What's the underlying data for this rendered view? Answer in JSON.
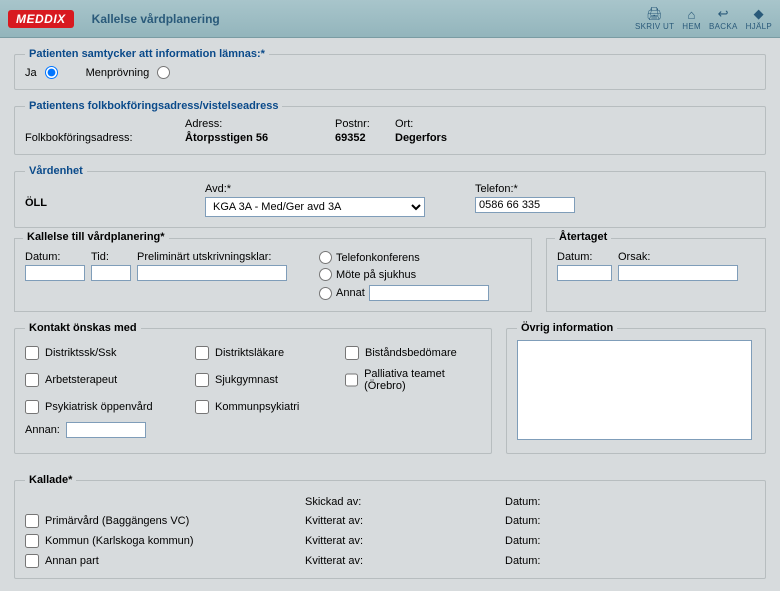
{
  "app": {
    "logo": "MEDDIX",
    "title": "Kallelse vårdplanering"
  },
  "toolbar": {
    "print": "SKRIV UT",
    "home": "HEM",
    "back": "BACKA",
    "help": "HJÄLP"
  },
  "consent": {
    "legend": "Patienten samtycker att information lämnas:*",
    "yes_label": "Ja",
    "trial_label": "Menprövning"
  },
  "address": {
    "legend": "Patientens folkbokföringsadress/vistelseadress",
    "addr_hdr": "Adress:",
    "post_hdr": "Postnr:",
    "ort_hdr": "Ort:",
    "folk_label": "Folkbokföringsadress:",
    "street": "Åtorpsstigen 56",
    "postnr": "69352",
    "ort": "Degerfors"
  },
  "unit": {
    "legend": "Vårdenhet",
    "org": "ÖLL",
    "dept_label": "Avd:*",
    "dept_value": "KGA 3A - Med/Ger avd 3A",
    "phone_label": "Telefon:*",
    "phone_value": "0586 66 335"
  },
  "callout": {
    "legend": "Kallelse till vårdplanering*",
    "date_label": "Datum:",
    "time_label": "Tid:",
    "prelim_label": "Preliminärt utskrivningsklar:",
    "opt_phone": "Telefonkonferens",
    "opt_hosp": "Möte på sjukhus",
    "opt_other": "Annat"
  },
  "retracted": {
    "legend": "Återtaget",
    "date_label": "Datum:",
    "reason_label": "Orsak:"
  },
  "contact": {
    "legend": "Kontakt önskas med",
    "c1": "Distriktssk/Ssk",
    "c2": "Distriktsläkare",
    "c3": "Biståndsbedömare",
    "c4": "Arbetsterapeut",
    "c5": "Sjukgymnast",
    "c6": "Palliativa teamet (Örebro)",
    "c7": "Psykiatrisk öppenvård",
    "c8": "Kommunpsykiatri",
    "other_label": "Annan:"
  },
  "info": {
    "legend": "Övrig information"
  },
  "summoned": {
    "legend": "Kallade*",
    "sent_by": "Skickad av:",
    "ack_by": "Kvitterat av:",
    "date_label": "Datum:",
    "r1": "Primärvård (Baggängens VC)",
    "r2": "Kommun (Karlskoga kommun)",
    "r3": "Annan part"
  }
}
